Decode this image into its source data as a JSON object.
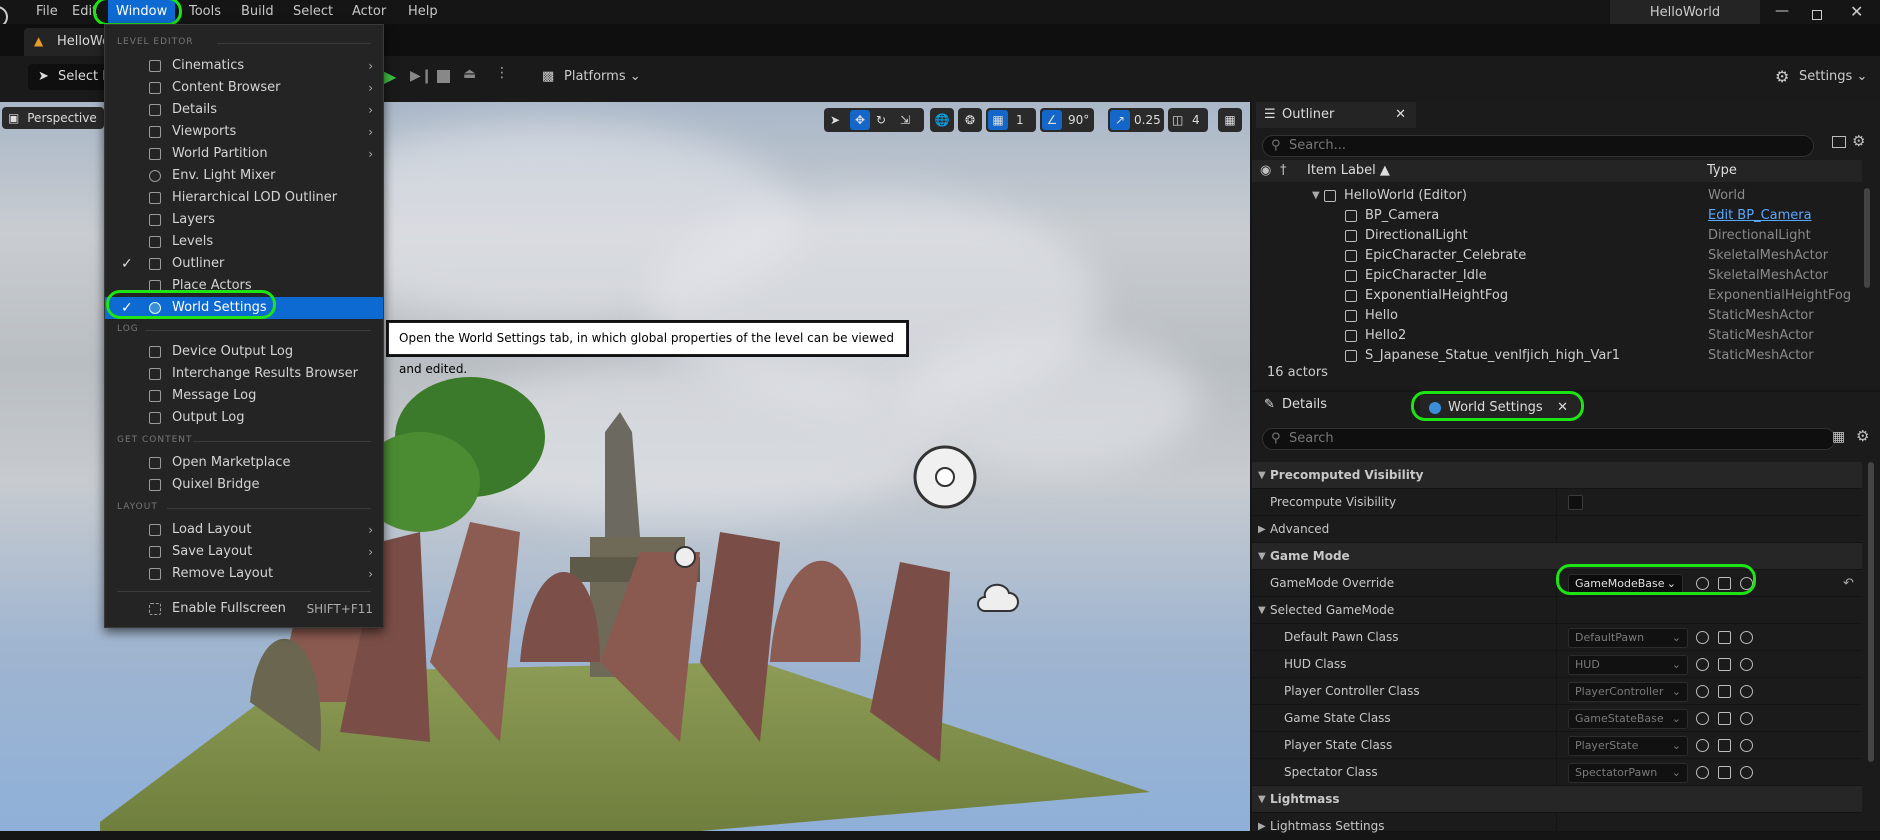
{
  "menubar": {
    "items": [
      "File",
      "Edit",
      "Window",
      "Tools",
      "Build",
      "Select",
      "Actor",
      "Help"
    ],
    "project_title": "HelloWorld"
  },
  "tab": {
    "label": "HelloWorld"
  },
  "toolbar": {
    "select_mode": "Select Mode",
    "platforms": "Platforms",
    "settings": "Settings"
  },
  "viewport": {
    "mode": "Perspective",
    "grid_value": "1",
    "angle_value": "90°",
    "scale_value": "0.25",
    "camera_speed": "4"
  },
  "window_menu": {
    "sections": {
      "level_editor": "LEVEL EDITOR",
      "log": "LOG",
      "get_content": "GET CONTENT",
      "layout": "LAYOUT"
    },
    "level_editor_items": [
      {
        "label": "Cinematics",
        "submenu": true,
        "checked": false
      },
      {
        "label": "Content Browser",
        "submenu": true,
        "checked": false
      },
      {
        "label": "Details",
        "submenu": true,
        "checked": false
      },
      {
        "label": "Viewports",
        "submenu": true,
        "checked": false
      },
      {
        "label": "World Partition",
        "submenu": true,
        "checked": false
      },
      {
        "label": "Env. Light Mixer",
        "submenu": false,
        "checked": false
      },
      {
        "label": "Hierarchical LOD Outliner",
        "submenu": false,
        "checked": false
      },
      {
        "label": "Layers",
        "submenu": false,
        "checked": false
      },
      {
        "label": "Levels",
        "submenu": false,
        "checked": false
      },
      {
        "label": "Outliner",
        "submenu": false,
        "checked": true
      },
      {
        "label": "Place Actors",
        "submenu": false,
        "checked": false
      },
      {
        "label": "World Settings",
        "submenu": false,
        "checked": true,
        "selected": true
      }
    ],
    "log_items": [
      "Device Output Log",
      "Interchange Results Browser",
      "Message Log",
      "Output Log"
    ],
    "content_items": [
      "Open Marketplace",
      "Quixel Bridge"
    ],
    "layout_items": [
      {
        "label": "Load Layout",
        "submenu": true
      },
      {
        "label": "Save Layout",
        "submenu": true
      },
      {
        "label": "Remove Layout",
        "submenu": true
      }
    ],
    "fullscreen": {
      "label": "Enable Fullscreen",
      "shortcut": "SHIFT+F11"
    }
  },
  "tooltip": "Open the World Settings tab, in which global properties of the level can be viewed and edited.",
  "outliner": {
    "tab_label": "Outliner",
    "search_placeholder": "Search...",
    "col_label": "Item Label ▲",
    "col_type": "Type",
    "rows": [
      {
        "name": "HelloWorld (Editor)",
        "type": "World",
        "depth": 0
      },
      {
        "name": "BP_Camera",
        "type": "Edit BP_Camera",
        "depth": 1,
        "link": true
      },
      {
        "name": "DirectionalLight",
        "type": "DirectionalLight",
        "depth": 1
      },
      {
        "name": "EpicCharacter_Celebrate",
        "type": "SkeletalMeshActor",
        "depth": 1
      },
      {
        "name": "EpicCharacter_Idle",
        "type": "SkeletalMeshActor",
        "depth": 1
      },
      {
        "name": "ExponentialHeightFog",
        "type": "ExponentialHeightFog",
        "depth": 1
      },
      {
        "name": "Hello",
        "type": "StaticMeshActor",
        "depth": 1
      },
      {
        "name": "Hello2",
        "type": "StaticMeshActor",
        "depth": 1
      },
      {
        "name": "S_Japanese_Statue_venlfjich_high_Var1",
        "type": "StaticMeshActor",
        "depth": 1
      }
    ],
    "count": "16 actors"
  },
  "details": {
    "details_tab": "Details",
    "world_settings_tab": "World Settings",
    "search_placeholder": "Search",
    "rows": [
      {
        "label": "Precomputed Visibility",
        "kind": "category"
      },
      {
        "label": "Precompute Visibility",
        "kind": "checkbox"
      },
      {
        "label": "Advanced",
        "kind": "collapsed"
      },
      {
        "label": "Game Mode",
        "kind": "category"
      },
      {
        "label": "GameMode Override",
        "kind": "combo",
        "value": "GameModeBase"
      },
      {
        "label": "Selected GameMode",
        "kind": "subcategory"
      },
      {
        "label": "Default Pawn Class",
        "kind": "combo-dim",
        "value": "DefaultPawn"
      },
      {
        "label": "HUD Class",
        "kind": "combo-dim",
        "value": "HUD"
      },
      {
        "label": "Player Controller Class",
        "kind": "combo-dim",
        "value": "PlayerController"
      },
      {
        "label": "Game State Class",
        "kind": "combo-dim",
        "value": "GameStateBase"
      },
      {
        "label": "Player State Class",
        "kind": "combo-dim",
        "value": "PlayerState"
      },
      {
        "label": "Spectator Class",
        "kind": "combo-dim",
        "value": "SpectatorPawn"
      },
      {
        "label": "Lightmass",
        "kind": "category"
      },
      {
        "label": "Lightmass Settings",
        "kind": "collapsed"
      }
    ]
  }
}
